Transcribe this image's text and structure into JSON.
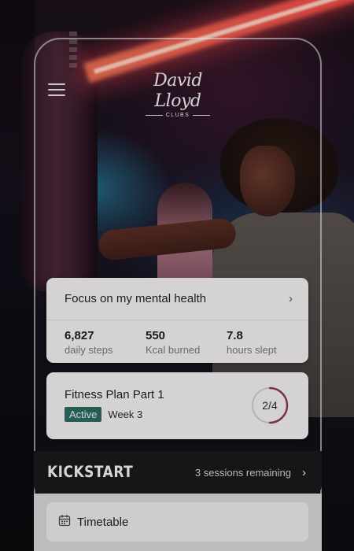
{
  "brand": {
    "name": "David Lloyd",
    "sub": "CLUBS"
  },
  "focus": {
    "title": "Focus on my mental health",
    "stats": [
      {
        "value": "6,827",
        "label": "daily steps"
      },
      {
        "value": "550",
        "label": "Kcal burned"
      },
      {
        "value": "7.8",
        "label": "hours slept"
      }
    ]
  },
  "plan": {
    "title": "Fitness Plan Part 1",
    "status": "Active",
    "week": "Week 3",
    "progress_text": "2/4",
    "progress_fraction": 0.5,
    "accent": "#8a3a5c"
  },
  "kickstart": {
    "title": "KICKSTART",
    "sessions": "3 sessions remaining"
  },
  "timetable": {
    "label": "Timetable"
  },
  "colors": {
    "badge": "#2c6b62",
    "card": "#f2f0f1",
    "banner": "#1b191c"
  },
  "icons": {
    "menu": "hamburger-icon",
    "chevron": "chevron-right-icon",
    "calendar": "calendar-icon"
  }
}
